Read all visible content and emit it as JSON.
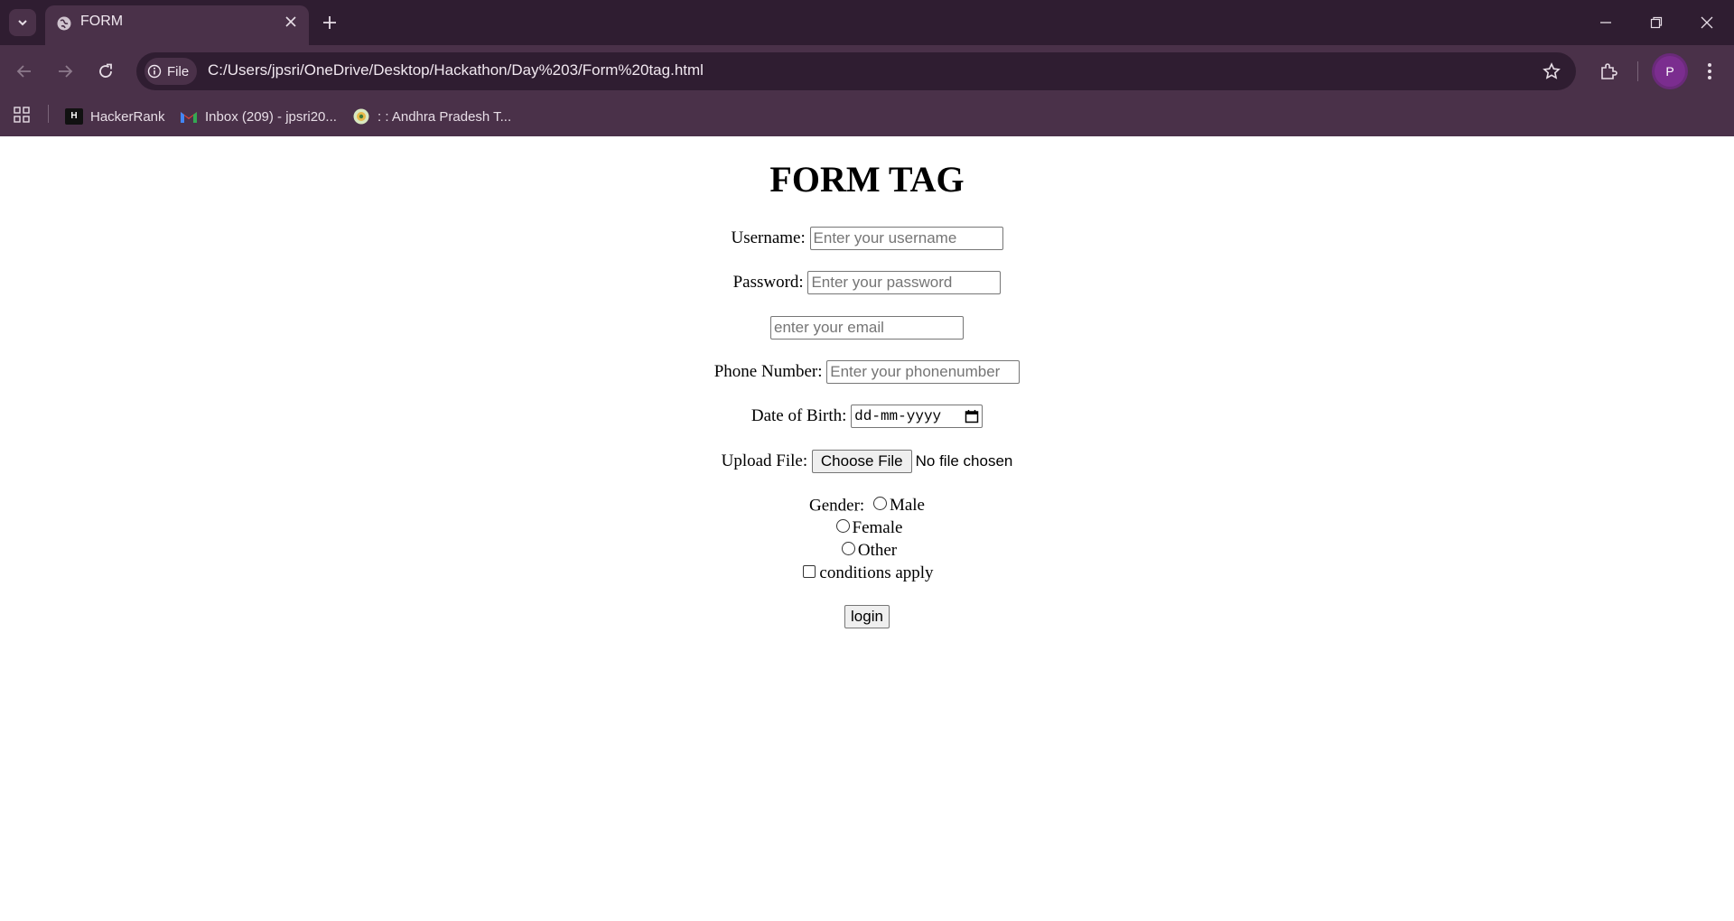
{
  "browser": {
    "tab_title": "FORM",
    "file_chip": "File",
    "url": "C:/Users/jpsri/OneDrive/Desktop/Hackathon/Day%203/Form%20tag.html",
    "profile_initial": "P",
    "bookmarks": [
      {
        "label": "HackerRank"
      },
      {
        "label": "Inbox (209) - jpsri20..."
      },
      {
        "label": ": : Andhra Pradesh T..."
      }
    ]
  },
  "form": {
    "heading": "FORM TAG",
    "username_label": "Username:",
    "username_placeholder": "Enter your username",
    "password_label": "Password:",
    "password_placeholder": "Enter your password",
    "email_placeholder": "enter your email",
    "phone_label": "Phone Number:",
    "phone_placeholder": "Enter your phonenumber",
    "dob_label": "Date of Birth:",
    "dob_placeholder": "dd-mm-yyyy",
    "upload_label": "Upload File:",
    "upload_button": "Choose File",
    "upload_status": "No file chosen",
    "gender_label": "Gender:",
    "gender_options": [
      "Male",
      "Female",
      "Other"
    ],
    "conditions_label": "conditions apply",
    "login_button": "login"
  }
}
